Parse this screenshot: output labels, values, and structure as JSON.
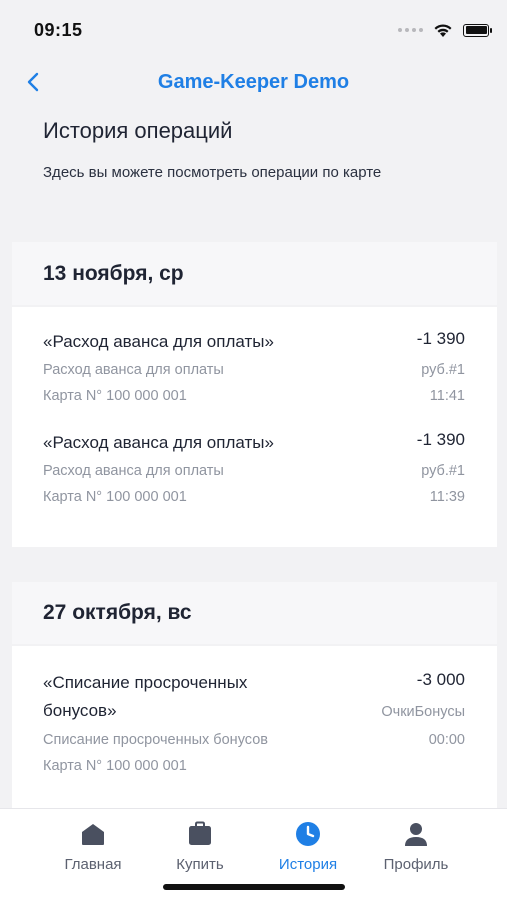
{
  "status": {
    "time": "09:15"
  },
  "nav": {
    "title": "Game-Keeper Demo"
  },
  "page": {
    "heading": "История операций",
    "description": "Здесь вы можете посмотреть операции по карте"
  },
  "days": [
    {
      "date": "13 ноября, ср",
      "operations": [
        {
          "title": "«Расход аванса для оплаты»",
          "amount": "-1 390",
          "subtitle": "Расход аванса для оплаты",
          "currency": "руб.#1",
          "card": "Карта N° 100 000 001",
          "time": "11:41"
        },
        {
          "title": "«Расход аванса для оплаты»",
          "amount": "-1 390",
          "subtitle": "Расход аванса для оплаты",
          "currency": "руб.#1",
          "card": "Карта N° 100 000 001",
          "time": "11:39"
        }
      ]
    },
    {
      "date": "27 октября, вс",
      "operations": [
        {
          "title_line1": "«Списание просроченных",
          "title_line2": "бонусов»",
          "amount": "-3 000",
          "currency": "ОчкиБонусы",
          "subtitle": "Списание просроченных бонусов",
          "time": "00:00",
          "card": "Карта N° 100 000 001"
        }
      ]
    }
  ],
  "tabs": [
    {
      "label": "Главная",
      "icon": "home-icon"
    },
    {
      "label": "Купить",
      "icon": "bag-icon"
    },
    {
      "label": "История",
      "icon": "clock-icon",
      "active": true
    },
    {
      "label": "Профиль",
      "icon": "profile-icon"
    }
  ],
  "colors": {
    "accent": "#1f7fe5",
    "background": "#f2f2f4",
    "muted": "#9095a0",
    "tab_icon": "#4a5060"
  }
}
